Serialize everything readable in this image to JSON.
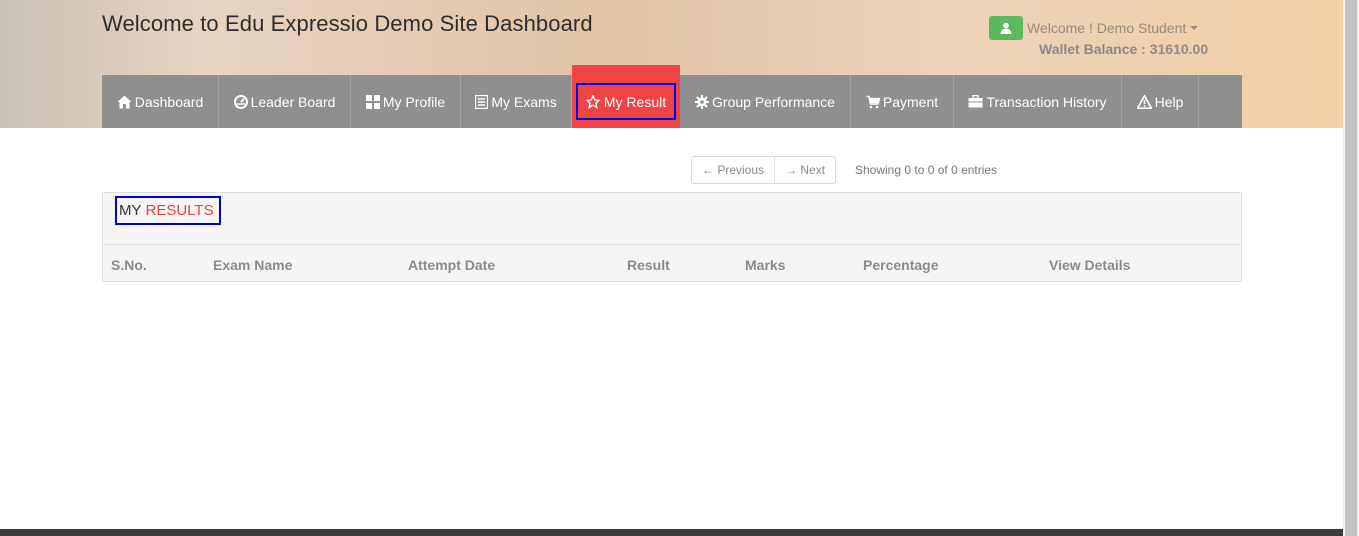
{
  "header": {
    "title": "Welcome to Edu Expressio Demo Site Dashboard",
    "user_welcome": "Welcome ! Demo Student",
    "wallet": "Wallet Balance : 31610.00",
    "user_icon_color": "#5cb85c"
  },
  "nav": {
    "items": [
      {
        "label": "Dashboard",
        "icon": "home-icon"
      },
      {
        "label": "Leader Board",
        "icon": "dashboard-gauge-icon"
      },
      {
        "label": "My Profile",
        "icon": "grid-icon"
      },
      {
        "label": "My Exams",
        "icon": "list-icon"
      },
      {
        "label": "My Result",
        "icon": "star-icon",
        "active": true
      },
      {
        "label": "Group Performance",
        "icon": "gear-icon"
      },
      {
        "label": "Payment",
        "icon": "cart-icon"
      },
      {
        "label": "Transaction History",
        "icon": "briefcase-icon"
      },
      {
        "label": "Help",
        "icon": "warning-icon"
      }
    ],
    "bar_color": "#8f8f8f",
    "active_color": "#ef4444"
  },
  "pager": {
    "previous": "← Previous",
    "next": "→ Next",
    "showing": "Showing 0 to 0 of 0 entries"
  },
  "panel": {
    "title_main": "MY",
    "title_accent": "RESULTS",
    "accent_color": "#e8423a"
  },
  "table": {
    "columns": [
      "S.No.",
      "Exam Name",
      "Attempt Date",
      "Result",
      "Marks",
      "Percentage",
      "View Details"
    ]
  }
}
